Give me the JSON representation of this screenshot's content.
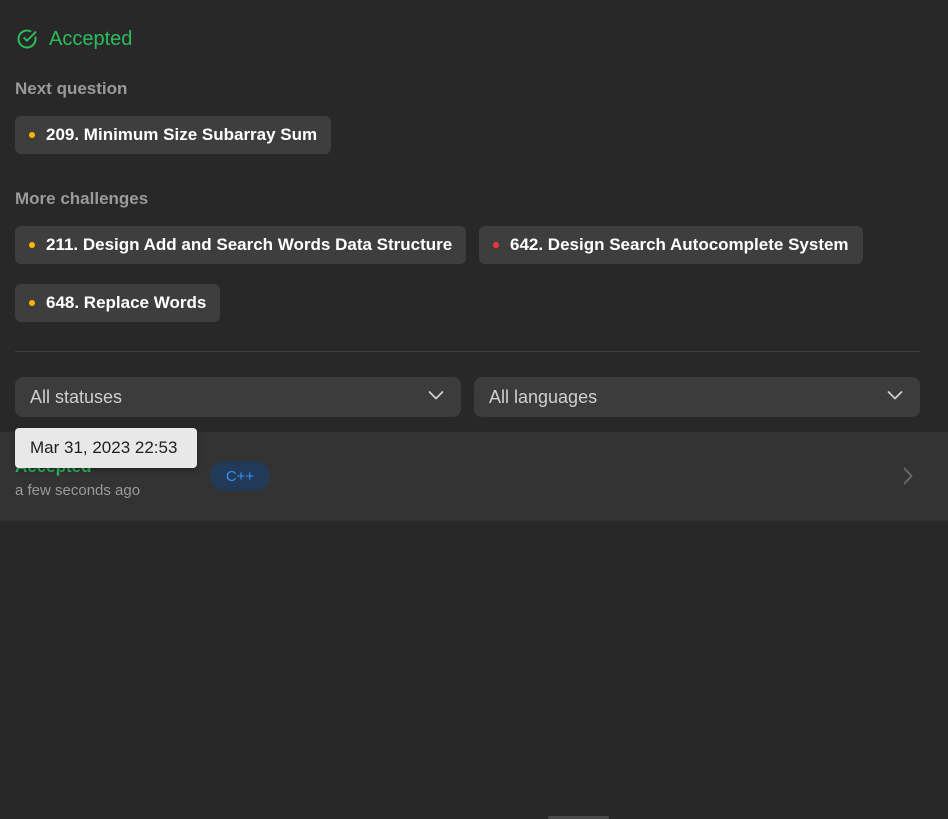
{
  "result": {
    "status": "Accepted",
    "icon": "check-circle-icon",
    "color": "#2cbb5d"
  },
  "next_question": {
    "heading": "Next question",
    "items": [
      {
        "label": "209. Minimum Size Subarray Sum",
        "difficulty_color": "#ffb800"
      }
    ]
  },
  "more_challenges": {
    "heading": "More challenges",
    "items": [
      {
        "label": "211. Design Add and Search Words Data Structure",
        "difficulty_color": "#ffb800"
      },
      {
        "label": "642. Design Search Autocomplete System",
        "difficulty_color": "#f63737"
      },
      {
        "label": "648. Replace Words",
        "difficulty_color": "#ffb800"
      }
    ]
  },
  "filters": {
    "status": {
      "value": "All statuses",
      "icon": "chevron-down-icon"
    },
    "language": {
      "value": "All languages",
      "icon": "chevron-down-icon"
    }
  },
  "submissions": [
    {
      "status": "Accepted",
      "time": "a few seconds ago",
      "language": "C++",
      "icon": "chevron-right-icon"
    }
  ],
  "tooltip": {
    "text": "Mar 31, 2023 22:53"
  }
}
